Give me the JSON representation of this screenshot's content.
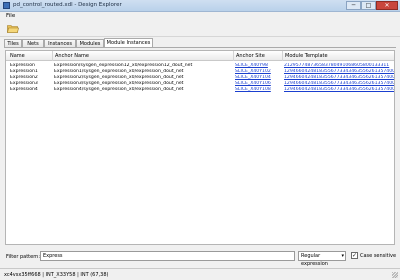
{
  "window": {
    "title": "pd_control_routed.xdl - Design Explorer",
    "min": "─",
    "max": "□",
    "close": "✕"
  },
  "menu": {
    "file": "File"
  },
  "tabs": [
    {
      "label": "Tiles"
    },
    {
      "label": "Nets"
    },
    {
      "label": "Instances"
    },
    {
      "label": "Modules"
    },
    {
      "label": "Module Instances",
      "active": true
    }
  ],
  "table": {
    "columns": [
      "Name",
      "Anchor Name",
      "Anchor Site",
      "Module Template"
    ],
    "rows": [
      {
        "name": "Expression",
        "anchor": "Expression/sysgen_expression12_x0/expression12_dout_net",
        "site": "SLICE_X40Y98",
        "template": "212957748736583780491068605800133311"
      },
      {
        "name": "Expression1",
        "anchor": "Expression1/sysgen_expression_x0/expression_dout_net",
        "site": "SLICE_X40Y102",
        "template": "129466042481835567733434635562613574000"
      },
      {
        "name": "Expression2",
        "anchor": "Expression2/sysgen_expression_x0/expression_dout_net",
        "site": "SLICE_X40Y104",
        "template": "129466042481835567733434635562613574000"
      },
      {
        "name": "Expression3",
        "anchor": "Expression3/sysgen_expression_x0/expression_dout_net",
        "site": "SLICE_X40Y106",
        "template": "129466042481835567733434635562613574000"
      },
      {
        "name": "Expression4",
        "anchor": "Expression4/sysgen_expression_x0/expression_dout_net",
        "site": "SLICE_X40Y108",
        "template": "129466042481835567733434635562613574000"
      }
    ]
  },
  "filter": {
    "label": "Filter pattern:",
    "value": "Express",
    "mode": "Regular expression",
    "mode_arrow": "▾",
    "case_sensitive_label": "Case sensitive",
    "case_sensitive": true,
    "check_mark": "✓"
  },
  "status": {
    "text": "xc4vsx35ff668 | INT_X33Y58 | INT (67,38)"
  }
}
